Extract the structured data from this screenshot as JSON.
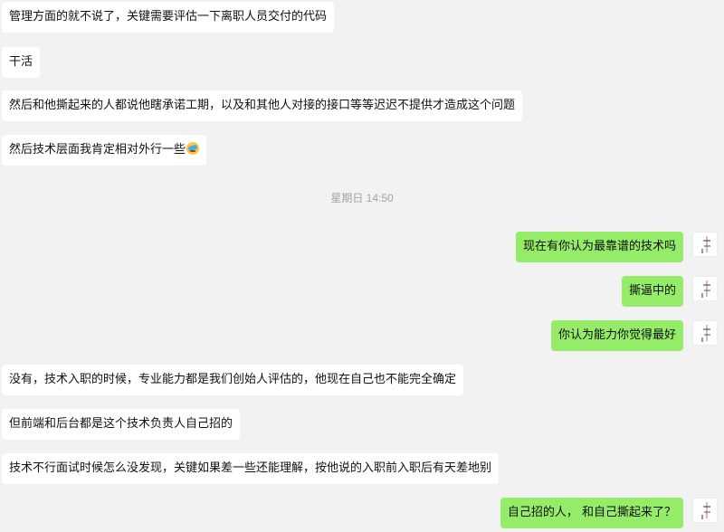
{
  "messages": [
    {
      "side": "in",
      "text": "管理方面的就不说了，关键需要评估一下离职人员交付的代码"
    },
    {
      "side": "in",
      "text": "干活"
    },
    {
      "side": "in",
      "text": "然后和他撕起来的人都说他瞎承诺工期，以及和其他人对接的接口等等迟迟不提供才造成这个问题"
    },
    {
      "side": "in",
      "text": "然后技术层面我肯定相对外行一些",
      "emoji": "laugh-cry-emoji"
    },
    {
      "side": "out",
      "text": "现在有你认为最靠谱的技术吗"
    },
    {
      "side": "out",
      "text": "撕逼中的"
    },
    {
      "side": "out",
      "text": "你认为能力你觉得最好"
    },
    {
      "side": "in",
      "text": "没有，技术入职的时候，专业能力都是我们创始人评估的，他现在自己也不能完全确定"
    },
    {
      "side": "in",
      "text": "但前端和后台都是这个技术负责人自己招的"
    },
    {
      "side": "in",
      "text": "技术不行面试时候怎么没发现，关键如果差一些还能理解，按他说的入职前入职后有天差地别"
    },
    {
      "side": "out",
      "text": "自己招的人， 和自己撕起来了？"
    }
  ],
  "timestamp": "星期日 14:50",
  "colors": {
    "background": "#f2f2f2",
    "incoming_bubble": "#ffffff",
    "outgoing_bubble": "#95ec69",
    "timestamp_text": "#a3a3a3"
  }
}
